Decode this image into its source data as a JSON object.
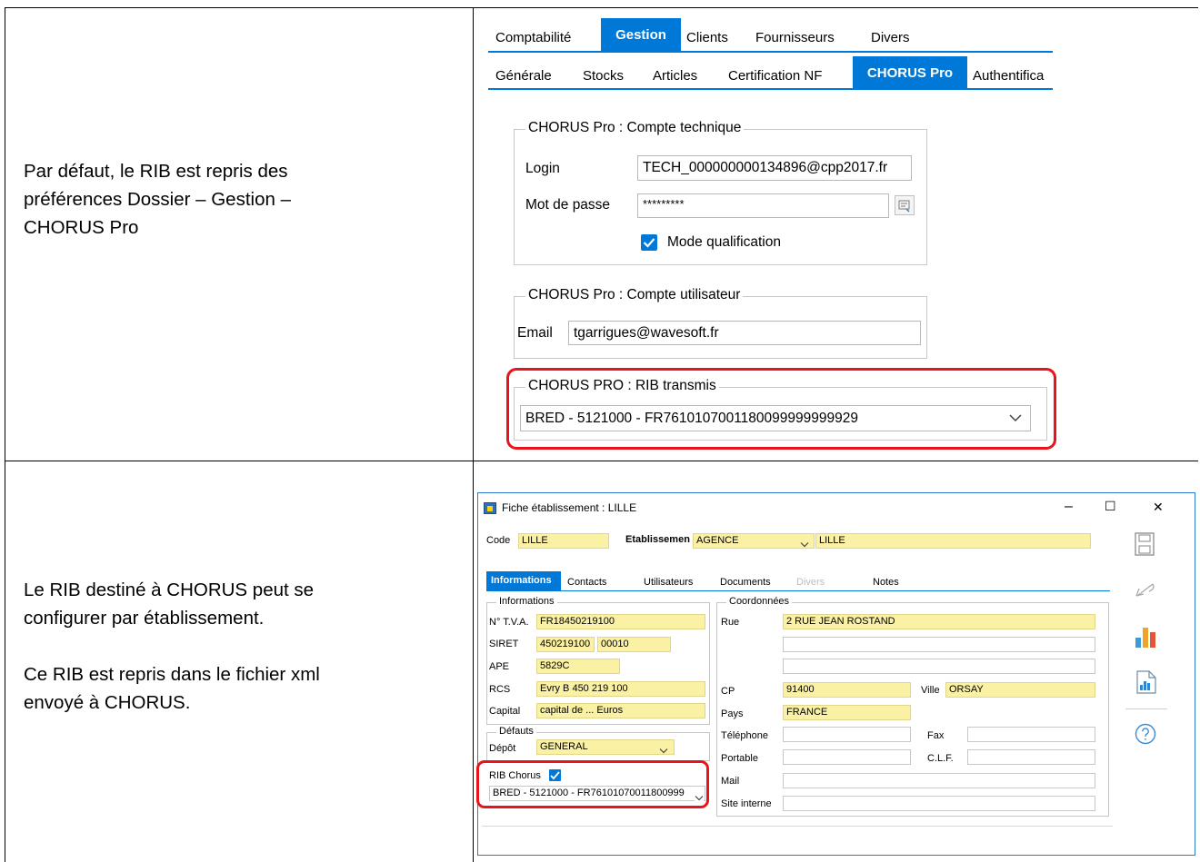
{
  "descriptions": {
    "row1": [
      "Par défaut, le RIB est repris des",
      "préférences Dossier – Gestion –",
      "CHORUS Pro"
    ],
    "row2_a": [
      "Le RIB destiné à CHORUS peut se",
      "configurer par établissement."
    ],
    "row2_b": [
      "Ce RIB est repris dans le fichier xml",
      "envoyé à CHORUS."
    ]
  },
  "prefs": {
    "top_tabs": [
      "Comptabilité",
      "Gestion",
      "Clients",
      "Fournisseurs",
      "Divers"
    ],
    "sub_tabs": [
      "Générale",
      "Stocks",
      "Articles",
      "Certification NF",
      "CHORUS Pro",
      "Authentifica"
    ],
    "tech_group": {
      "title": "CHORUS Pro : Compte technique",
      "login_label": "Login",
      "login_value": "TECH_000000000134896@cpp2017.fr",
      "password_label": "Mot de passe",
      "password_value": "*********",
      "qualification_label": "Mode qualification",
      "qualification_checked": true
    },
    "user_group": {
      "title": "CHORUS Pro : Compte utilisateur",
      "email_label": "Email",
      "email_value": "tgarrigues@wavesoft.fr"
    },
    "rib_group": {
      "title": "CHORUS PRO : RIB transmis",
      "rib_value": "BRED - 5121000 - FR7610107001180099999999929"
    }
  },
  "window": {
    "title": "Fiche établissement : LILLE",
    "controls": {
      "minimize": "–",
      "maximize": "☐",
      "close": "✕"
    },
    "header": {
      "code_label": "Code",
      "code_value": "LILLE",
      "etab_label": "Etablissemen",
      "etab_value": "AGENCE",
      "etab_name": "LILLE"
    },
    "tabs": [
      "Informations",
      "Contacts",
      "Utilisateurs",
      "Documents",
      "Divers",
      "Notes"
    ],
    "informations": {
      "title": "Informations",
      "tva_label": "N° T.V.A.",
      "tva_value": "FR18450219100",
      "siret_label": "SIRET",
      "siret_value_1": "450219100",
      "siret_value_2": "00010",
      "ape_label": "APE",
      "ape_value": "5829C",
      "rcs_label": "RCS",
      "rcs_value": "Evry B 450 219 100",
      "capital_label": "Capital",
      "capital_value": "capital de ... Euros"
    },
    "defauts": {
      "title": "Défauts",
      "depot_label": "Dépôt",
      "depot_value": "GENERAL",
      "rib_label": "RIB Chorus",
      "rib_checked": true,
      "rib_value": "BRED - 5121000 - FR76101070011800999"
    },
    "coordonnees": {
      "title": "Coordonnées",
      "rue_label": "Rue",
      "rue_value": "2 RUE JEAN ROSTAND",
      "cp_label": "CP",
      "cp_value": "91400",
      "ville_label": "Ville",
      "ville_value": "ORSAY",
      "pays_label": "Pays",
      "pays_value": "FRANCE",
      "telephone_label": "Téléphone",
      "fax_label": "Fax",
      "portable_label": "Portable",
      "clf_label": "C.L.F.",
      "mail_label": "Mail",
      "site_label": "Site interne"
    }
  },
  "colors": {
    "accent": "#0078d7",
    "highlight": "#e8131b",
    "field_yellow": "#fbf1a5"
  }
}
